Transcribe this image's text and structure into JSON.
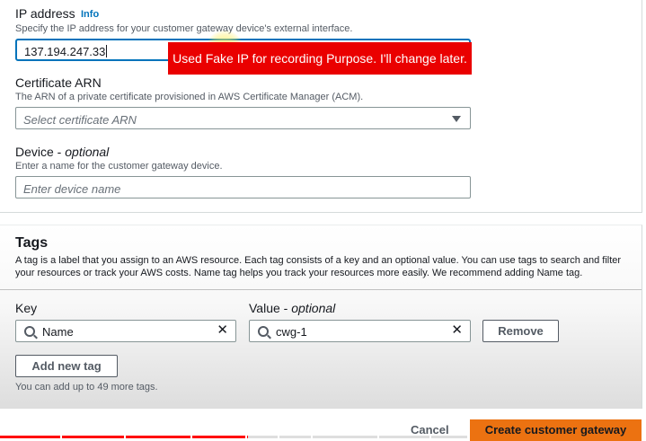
{
  "ip_section": {
    "label": "IP address",
    "info_link": "Info",
    "description": "Specify the IP address for your customer gateway device's external interface.",
    "value": "137.194.247.33"
  },
  "overlay": {
    "text": "Used Fake IP for recording Purpose. I'll change later.",
    "color": "#ea0000"
  },
  "certificate_section": {
    "label": "Certificate ARN",
    "description": "The ARN of a private certificate provisioned in AWS Certificate Manager (ACM).",
    "placeholder": "Select certificate ARN",
    "icon": "caret-down-icon"
  },
  "device_section": {
    "label": "Device",
    "label_optional": "optional",
    "description": "Enter a name for the customer gateway device.",
    "placeholder": "Enter device name"
  },
  "tags_section": {
    "title": "Tags",
    "description": "A tag is a label that you assign to an AWS resource. Each tag consists of a key and an optional value. You can use tags to search and filter your resources or track your AWS costs. Name tag helps you track your resources more easily. We recommend adding Name tag.",
    "key_label": "Key",
    "value_label": "Value",
    "value_label_optional": "optional",
    "key_value": "Name",
    "value_value": "cwg-1",
    "remove_label": "Remove",
    "add_tag_label": "Add new tag",
    "limit_hint": "You can add up to 49 more tags.",
    "icons": [
      "search-icon",
      "close-icon"
    ]
  },
  "footer": {
    "cancel_label": "Cancel",
    "create_label": "Create customer gateway",
    "primary_color": "#ec7211"
  },
  "video_progress": {
    "played_fraction": 0.53,
    "color": "#ff0000"
  }
}
